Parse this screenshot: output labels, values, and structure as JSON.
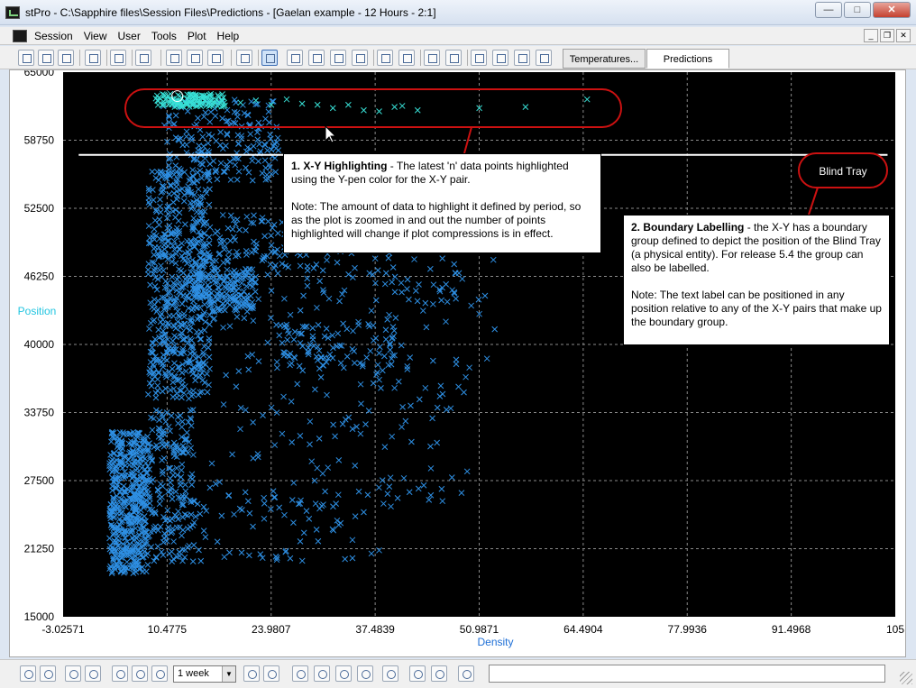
{
  "window": {
    "title": "stPro - C:\\Sapphire files\\Session Files\\Predictions - [Gaelan example - 12 Hours - 2:1]",
    "controls": {
      "minimize": "—",
      "maximize": "□",
      "close": "✕"
    }
  },
  "menu": {
    "items": [
      "Session",
      "View",
      "User",
      "Tools",
      "Plot",
      "Help"
    ],
    "mdi_controls": {
      "minimize": "_",
      "restore": "❐",
      "close": "✕"
    }
  },
  "toolbar": {
    "icons": [
      "new-icon",
      "open-icon",
      "open-folder-icon",
      "save-icon",
      "print-icon",
      "help-cursor-icon",
      "layout-single-icon",
      "layout-horizontal-icon",
      "layout-vertical-icon",
      "new-plot-icon",
      "run-icon",
      "add-pen-icon",
      "add-chart-icon",
      "add-trend-icon",
      "add-xy-icon",
      "check-icon",
      "check-disabled-icon",
      "xy-plot-icon",
      "xy-plot-alt-icon",
      "export-icon",
      "copy-icon",
      "annotate-icon",
      "properties-icon"
    ],
    "tabs": [
      {
        "label": "Temperatures...",
        "selected": false
      },
      {
        "label": "Predictions",
        "selected": true
      }
    ]
  },
  "chart_data": {
    "type": "scatter",
    "xlabel": "Density",
    "ylabel": "Position",
    "x_ticks": [
      "-3.02571",
      "10.4775",
      "23.9807",
      "37.4839",
      "50.9871",
      "64.4904",
      "77.9936",
      "91.4968",
      "105"
    ],
    "y_ticks": [
      "65000",
      "58750",
      "52500",
      "46250",
      "40000",
      "33750",
      "27500",
      "21250",
      "15000"
    ],
    "xlim": [
      -3.02571,
      105
    ],
    "ylim": [
      15000,
      65000
    ],
    "grid": true,
    "background": "#000000",
    "colors": {
      "series": "#2e8fe3",
      "highlight": "#38e0d6",
      "boundary": "#ffffff",
      "callout": "#cc1111",
      "ylabel": "#23c5e0",
      "xlabel": "#1e6fd6"
    },
    "series": [
      {
        "role": "main",
        "marker": "x",
        "color": "#2e8fe3",
        "regions": [
          {
            "x": [
              3,
              8
            ],
            "y": [
              19000,
              32000
            ],
            "n": 500
          },
          {
            "x": [
              8,
              14
            ],
            "y": [
              20000,
              34000
            ],
            "n": 200
          },
          {
            "x": [
              8,
              16
            ],
            "y": [
              35000,
              56000
            ],
            "n": 550
          },
          {
            "x": [
              14,
              22
            ],
            "y": [
              43000,
              47000
            ],
            "n": 180
          },
          {
            "x": [
              14,
              30
            ],
            "y": [
              47000,
              52000
            ],
            "n": 120
          },
          {
            "x": [
              10,
              25
            ],
            "y": [
              55000,
              62500
            ],
            "n": 200
          },
          {
            "x": [
              25,
              40
            ],
            "y": [
              38000,
              42000
            ],
            "n": 80
          },
          {
            "x": [
              16,
              50
            ],
            "y": [
              25000,
              50000
            ],
            "n": 220
          },
          {
            "x": [
              12,
              35
            ],
            "y": [
              20000,
              26000
            ],
            "n": 60
          },
          {
            "x": [
              30,
              55
            ],
            "y": [
              44000,
              48000
            ],
            "n": 30
          }
        ],
        "points": [
          [
            38,
            39200
          ],
          [
            40,
            39000
          ],
          [
            42,
            38800
          ],
          [
            45,
            38500
          ],
          [
            48,
            38200
          ],
          [
            52,
            38700
          ],
          [
            40,
            36000
          ],
          [
            44,
            36000
          ],
          [
            46,
            36200
          ],
          [
            49,
            35600
          ],
          [
            33,
            23600
          ],
          [
            36,
            24600
          ],
          [
            37,
            20800
          ],
          [
            44,
            43800
          ],
          [
            53,
            41400
          ],
          [
            51,
            42800
          ],
          [
            37,
            43100
          ],
          [
            45,
            43700
          ],
          [
            38,
            21100
          ],
          [
            48,
            38600
          ]
        ]
      },
      {
        "role": "highlight",
        "marker": "x",
        "color": "#38e0d6",
        "regions": [
          {
            "x": [
              9,
              18
            ],
            "y": [
              61800,
              63000
            ],
            "n": 130
          }
        ],
        "points": [
          [
            20,
            62200
          ],
          [
            22,
            62400
          ],
          [
            24,
            62000
          ],
          [
            26,
            62500
          ],
          [
            28,
            62100
          ],
          [
            30,
            62000
          ],
          [
            32,
            61700
          ],
          [
            34,
            62000
          ],
          [
            36,
            61500
          ],
          [
            38,
            61400
          ],
          [
            40,
            61800
          ],
          [
            41,
            61900
          ],
          [
            43,
            61500
          ],
          [
            51,
            61700
          ],
          [
            57,
            61800
          ],
          [
            65,
            62500
          ]
        ]
      }
    ],
    "boundary": {
      "x": [
        -1,
        104
      ],
      "y": 57400,
      "label": "Blind Tray"
    },
    "annotations": [
      {
        "heading": "1.  X-Y Highlighting",
        "lines": [
          " - The latest 'n' data points highlighted using the Y-pen color for the X-Y pair.",
          "Note:  The amount of data to highlight it defined by period, so as the plot is zoomed in and out the number of points highlighted will change if plot compressions is in effect."
        ]
      },
      {
        "heading": "2.  Boundary Labelling",
        "lines": [
          " - the X-Y has a boundary group defined to depict the position of the Blind Tray (a physical entity).  For release 5.4 the group can also be labelled.",
          "Note:  The text label can be positioned in any position relative to any of the X-Y pairs that make up the boundary group."
        ]
      }
    ]
  },
  "statusbar": {
    "period_value": "1 week",
    "icons": [
      "zoom-out-icon",
      "zoom-in-icon",
      "back-icon",
      "forward-icon",
      "alarm-icon",
      "group-icon",
      "clock-icon",
      "scroll-icon",
      "chart-options-icon",
      "folder-icon",
      "window-icon",
      "window-alt-icon",
      "window-duo-icon",
      "check-chart-icon",
      "folder-save-icon",
      "save-disk-icon",
      "tools-icon"
    ],
    "text_field_value": ""
  }
}
